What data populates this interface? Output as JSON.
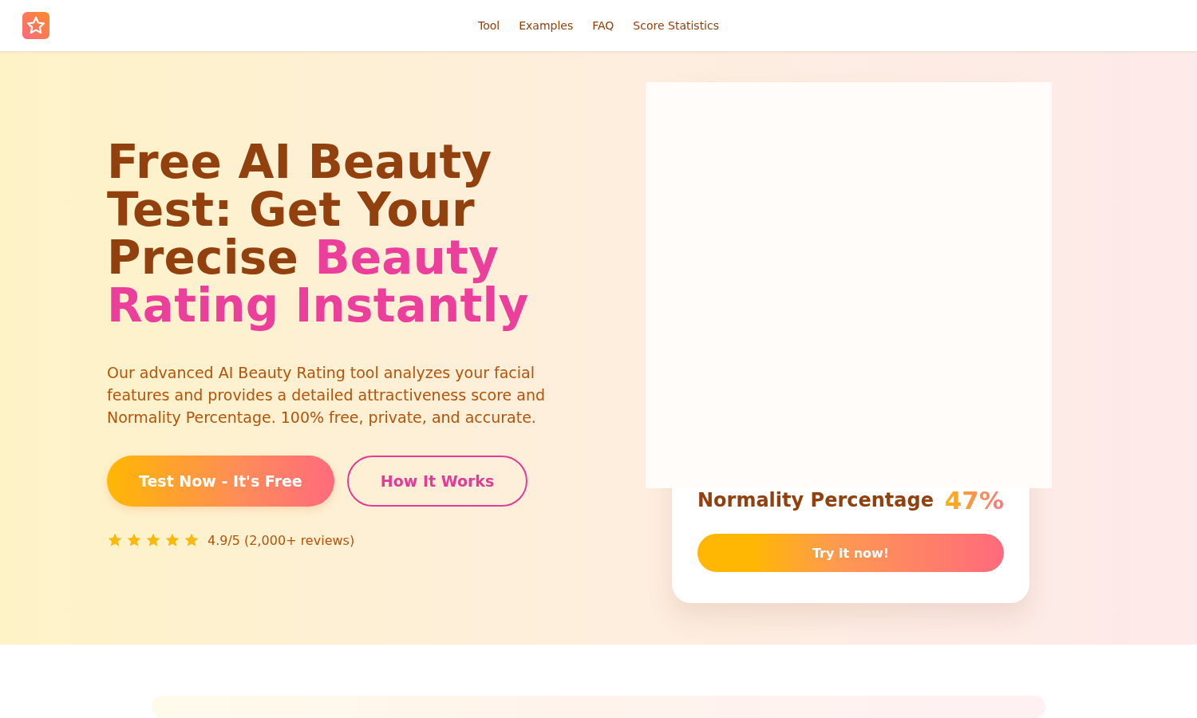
{
  "nav": {
    "links": [
      "Tool",
      "Examples",
      "FAQ",
      "Score Statistics"
    ]
  },
  "hero": {
    "title_lead": "Free AI Beauty Test: Get Your Precise ",
    "title_highlight": "Beauty Rating Instantly",
    "description": "Our advanced AI Beauty Rating tool analyzes your facial features and provides a detailed attractiveness score and Normality Percentage. 100% free, private, and accurate.",
    "primary_button": "Test Now - It's Free",
    "secondary_button": "How It Works",
    "rating": {
      "stars": 5,
      "text": "4.9/5 (2,000+ reviews)"
    }
  },
  "preview_card": {
    "label": "Normality Percentage",
    "value": "47%",
    "button": "Try it now!"
  }
}
